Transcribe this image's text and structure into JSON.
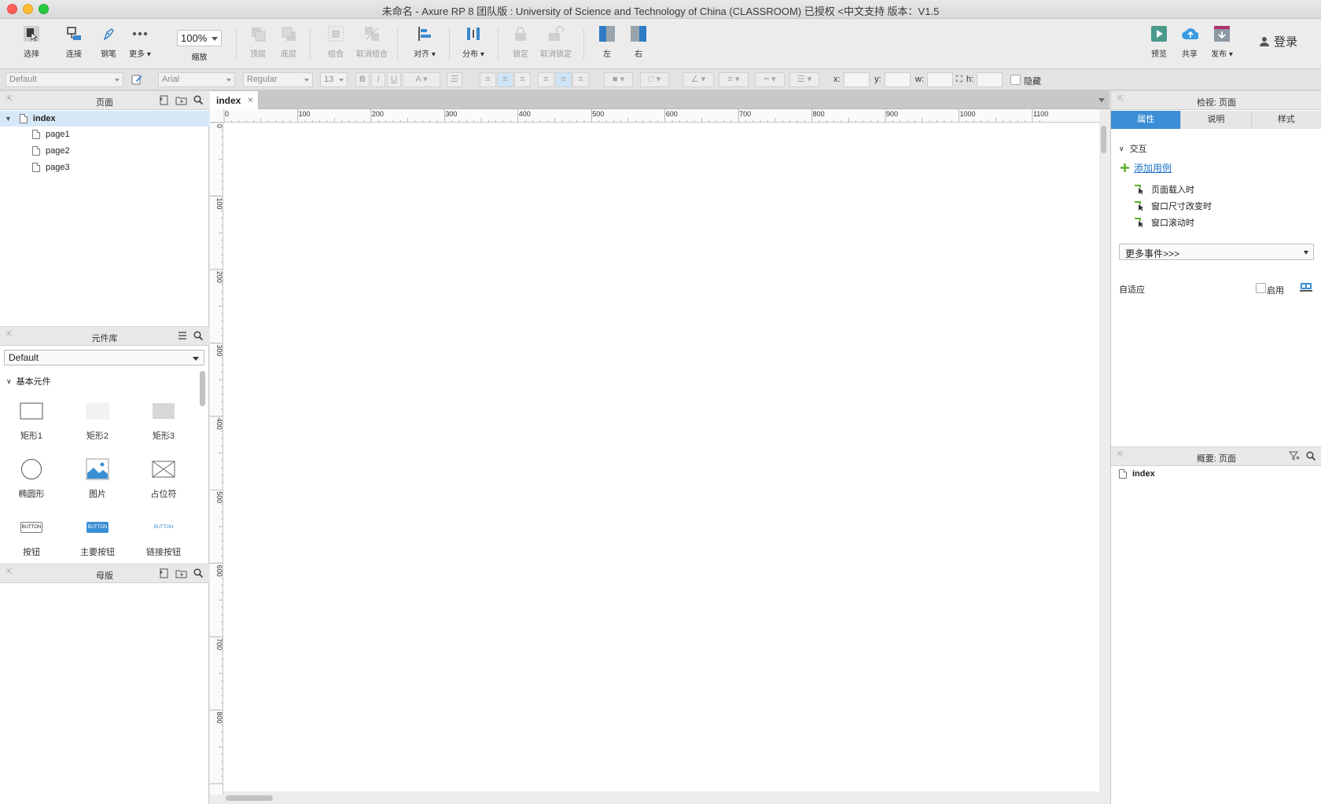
{
  "window": {
    "title": "未命名 - Axure RP 8 团队版 : University of Science and Technology of China (CLASSROOM) 已授权     <中文支持 版本：V1.5"
  },
  "toolbar": {
    "select": "选择",
    "connect": "连接",
    "pen": "钢笔",
    "more": "更多 ▾",
    "zoom_value": "100%",
    "zoom_label": "缩放",
    "top": "顶层",
    "bottom": "底层",
    "group": "组合",
    "ungroup": "取消组合",
    "align": "对齐 ▾",
    "distribute": "分布 ▾",
    "lock": "锁定",
    "unlock": "取消锁定",
    "left": "左",
    "right": "右",
    "preview": "预览",
    "share": "共享",
    "publish": "发布 ▾",
    "login": "登录"
  },
  "formatbar": {
    "style": "Default",
    "font": "Arial",
    "weight": "Regular",
    "size": "13",
    "bold": "B",
    "italic": "I",
    "underline": "U",
    "font_color": "A",
    "x_label": "x:",
    "y_label": "y:",
    "w_label": "w:",
    "h_label": "h:",
    "hidden_label": "隐藏"
  },
  "pages": {
    "title": "页面",
    "root": "index",
    "items": [
      "page1",
      "page2",
      "page3"
    ]
  },
  "library": {
    "title": "元件库",
    "selected": "Default",
    "category": "基本元件",
    "widgets": [
      {
        "label": "矩形1",
        "icon": "rectangle-icon"
      },
      {
        "label": "矩形2",
        "icon": "rectangle-icon"
      },
      {
        "label": "矩形3",
        "icon": "rectangle-icon"
      },
      {
        "label": "椭圆形",
        "icon": "ellipse-icon"
      },
      {
        "label": "图片",
        "icon": "image-icon"
      },
      {
        "label": "占位符",
        "icon": "placeholder-icon"
      },
      {
        "label": "按钮",
        "icon": "button-icon",
        "text": "BUTTON"
      },
      {
        "label": "主要按钮",
        "icon": "primary-button-icon",
        "text": "BUTTON"
      },
      {
        "label": "链接按钮",
        "icon": "link-button-icon",
        "text": "BUTTON"
      }
    ]
  },
  "masters": {
    "title": "母版"
  },
  "canvas": {
    "tab": "index",
    "ruler_h": [
      "0",
      "100",
      "200",
      "300",
      "400",
      "500",
      "600",
      "700",
      "800",
      "900",
      "1000",
      "1100"
    ],
    "ruler_v": [
      "0",
      "100",
      "200",
      "300",
      "400",
      "500",
      "600",
      "700",
      "800"
    ]
  },
  "inspector": {
    "title": "检视: 页面",
    "tabs": [
      "属性",
      "说明",
      "样式"
    ],
    "interaction": "交互",
    "add_case": "添加用例",
    "events": [
      "页面载入时",
      "窗口尺寸改变时",
      "窗口滚动时"
    ],
    "more_events": "更多事件>>>",
    "adaptive": "自适应",
    "enable": "启用"
  },
  "outline": {
    "title": "概要: 页面",
    "item": "index"
  },
  "colors": {
    "accent": "#3b8ed6",
    "selection": "#d6e8f7",
    "event_icon": "#5cb030"
  }
}
